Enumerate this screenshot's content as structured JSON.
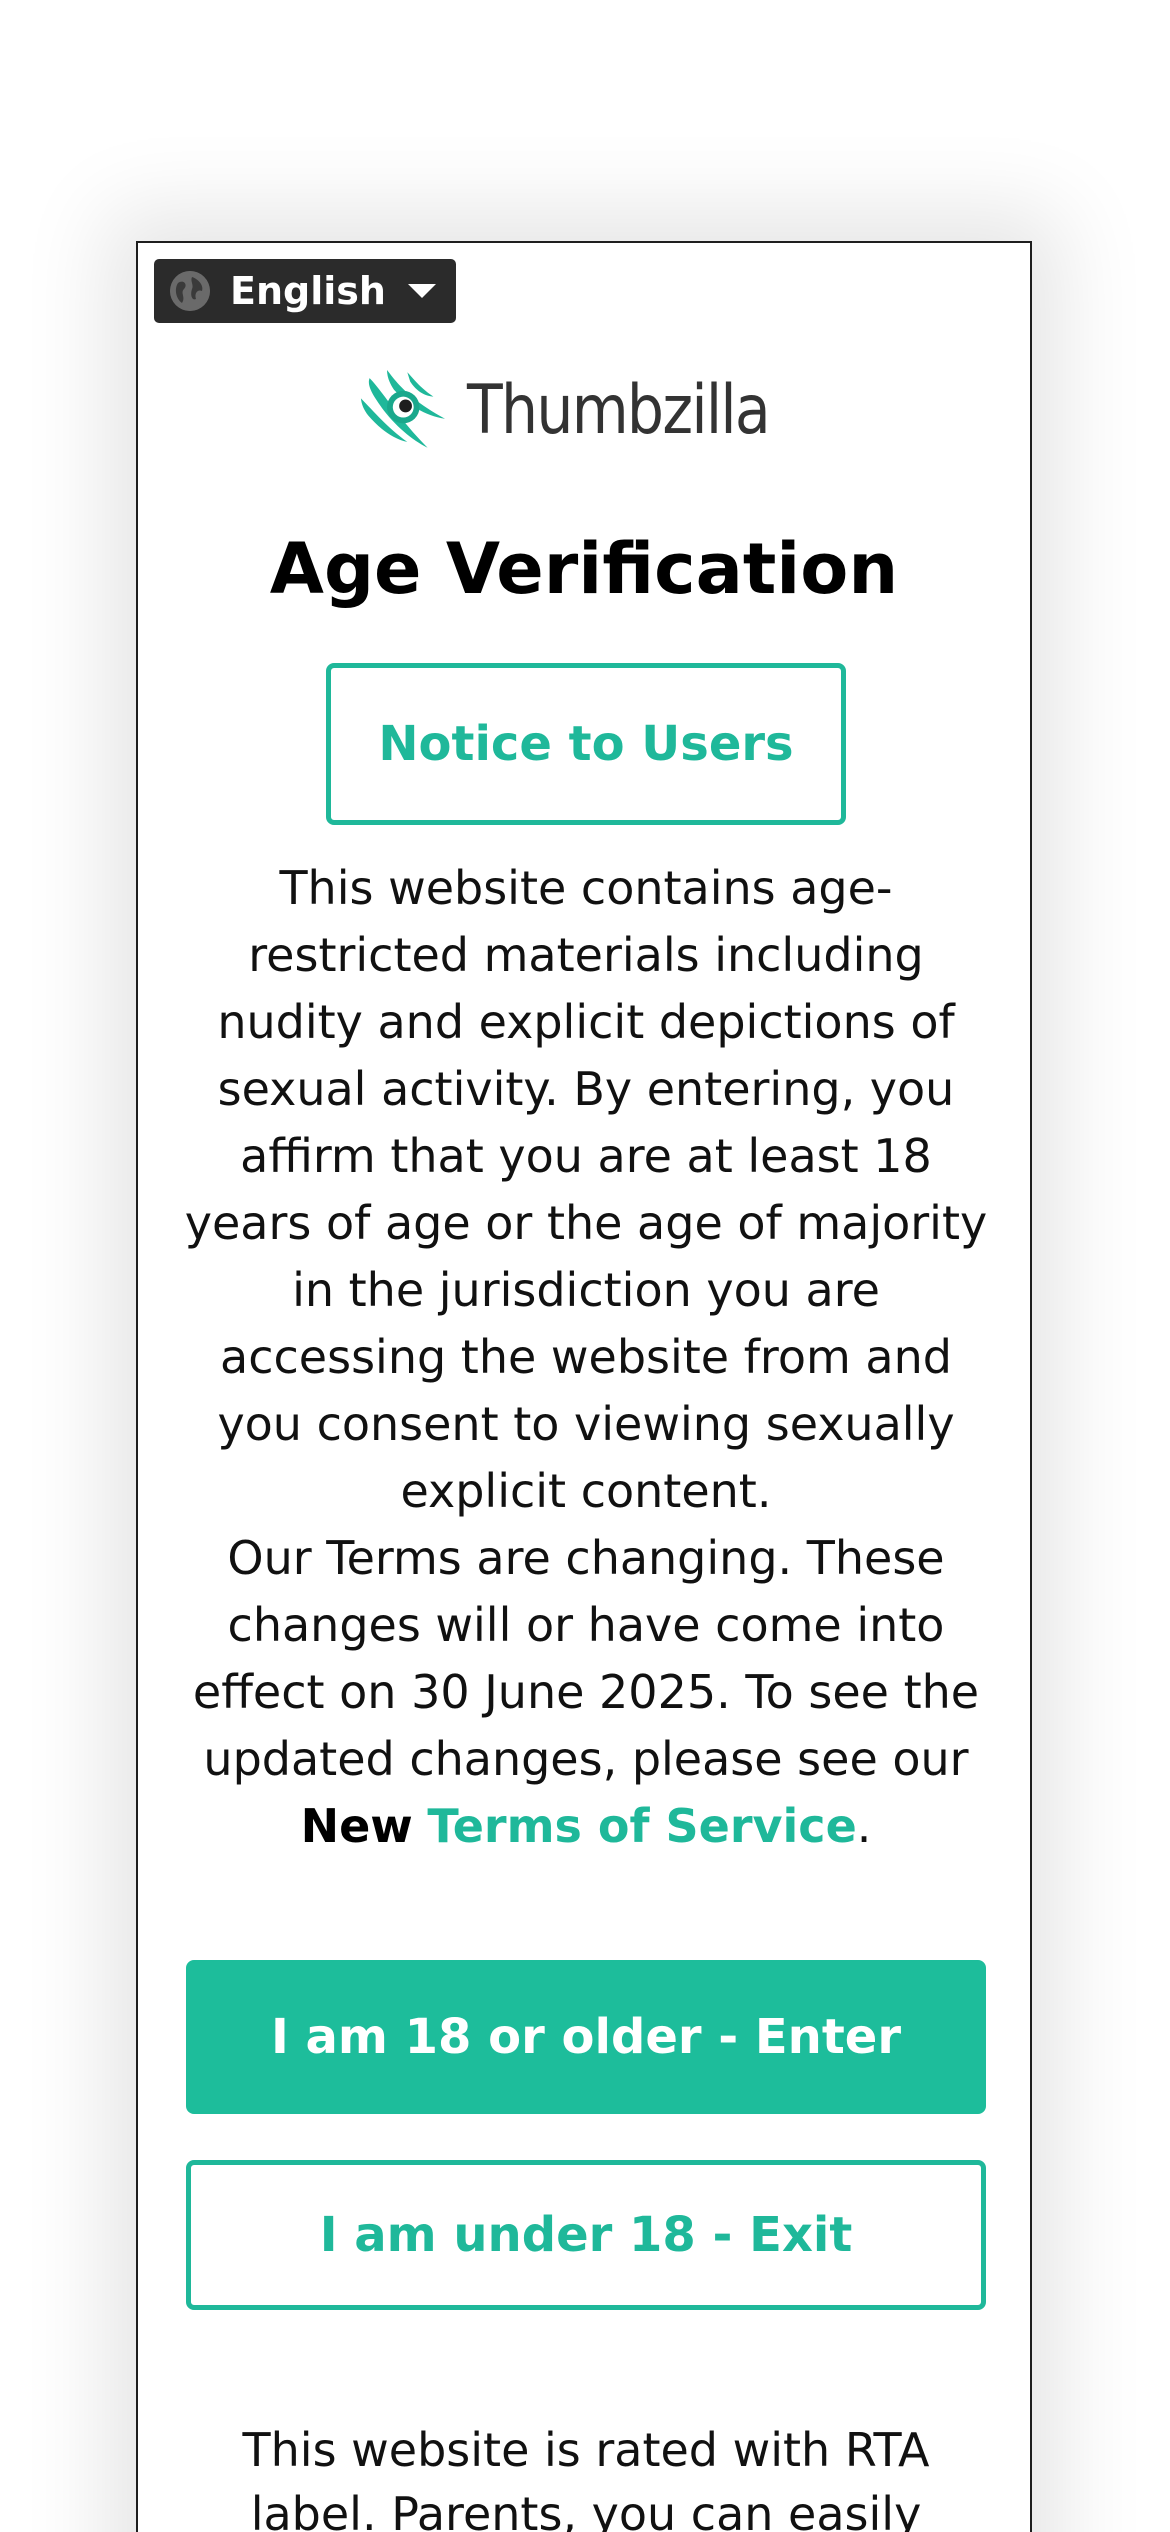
{
  "language_selector": {
    "label": "English",
    "globe_icon": "globe-icon",
    "caret_icon": "chevron-down-icon"
  },
  "logo": {
    "text": "Thumbzilla",
    "accent_color": "#1fb89a"
  },
  "title": "Age Verification",
  "notice_button": "Notice to Users",
  "body": {
    "paragraph1": "This website contains age-restricted materials including nudity and explicit depictions of sexual activity. By entering, you affirm that you are at least 18 years of age or the age of majority in the jurisdiction you are accessing the website from and you consent to viewing sexually explicit content.",
    "paragraph2_prefix": "Our Terms are changing. These changes will or have come into effect on 30 June 2025. To see the updated changes, please see our ",
    "paragraph2_new": "New",
    "paragraph2_link": "Terms of Service",
    "paragraph2_suffix": "."
  },
  "enter_button": "I am 18 or older - Enter",
  "exit_button": "I am under 18 - Exit",
  "rta_text": "This website is rated with RTA label. Parents, you can easily",
  "colors": {
    "accent": "#1dbd9b",
    "dark": "#2b2b2b"
  }
}
